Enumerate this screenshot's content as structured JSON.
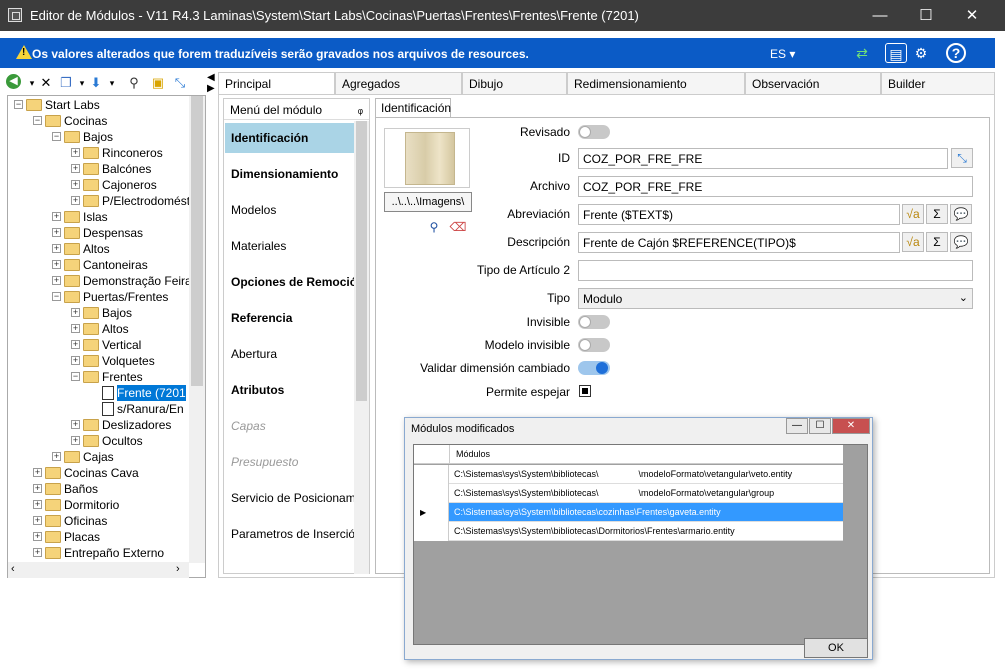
{
  "window": {
    "title": "Editor de Módulos - V11 R4.3 Laminas\\System\\Start Labs\\Cocinas\\Puertas\\Frentes\\Frentes\\Frente (7201)",
    "minimize": "—",
    "maximize": "☐",
    "close": "✕"
  },
  "infobar": {
    "message": "Os valores alterados que forem traduzíveis serão gravados nos arquivos de resources.",
    "language": "ES ▾",
    "bg_color": "#0b5bc6"
  },
  "tree": {
    "nodes": [
      {
        "label": "Start Labs",
        "level": 0,
        "expander": "−",
        "icon": "folder-open-icon"
      },
      {
        "label": "Cocinas",
        "level": 1,
        "expander": "−",
        "icon": "folder-open-icon"
      },
      {
        "label": "Bajos",
        "level": 2,
        "expander": "−",
        "icon": "folder-open-icon"
      },
      {
        "label": "Rinconeros",
        "level": 3,
        "expander": "+",
        "icon": "folder-icon"
      },
      {
        "label": "Balcónes",
        "level": 3,
        "expander": "+",
        "icon": "folder-icon"
      },
      {
        "label": "Cajoneros",
        "level": 3,
        "expander": "+",
        "icon": "folder-icon"
      },
      {
        "label": "P/Electrodomést",
        "level": 3,
        "expander": "+",
        "icon": "folder-icon"
      },
      {
        "label": "Islas",
        "level": 2,
        "expander": "+",
        "icon": "folder-icon"
      },
      {
        "label": "Despensas",
        "level": 2,
        "expander": "+",
        "icon": "folder-icon"
      },
      {
        "label": "Altos",
        "level": 2,
        "expander": "+",
        "icon": "folder-icon"
      },
      {
        "label": "Cantoneiras",
        "level": 2,
        "expander": "+",
        "icon": "folder-icon"
      },
      {
        "label": "Demonstração Feira",
        "level": 2,
        "expander": "+",
        "icon": "folder-icon"
      },
      {
        "label": "Puertas/Frentes",
        "level": 2,
        "expander": "−",
        "icon": "folder-open-icon"
      },
      {
        "label": "Bajos",
        "level": 3,
        "expander": "+",
        "icon": "folder-icon"
      },
      {
        "label": "Altos",
        "level": 3,
        "expander": "+",
        "icon": "folder-icon"
      },
      {
        "label": "Vertical",
        "level": 3,
        "expander": "+",
        "icon": "folder-icon"
      },
      {
        "label": "Volquetes",
        "level": 3,
        "expander": "+",
        "icon": "folder-icon"
      },
      {
        "label": "Frentes",
        "level": 3,
        "expander": "−",
        "icon": "folder-open-icon"
      },
      {
        "label": "Frente (7201",
        "level": 4,
        "expander": "",
        "icon": "module-icon",
        "selected": true
      },
      {
        "label": "s/Ranura/En",
        "level": 4,
        "expander": "",
        "icon": "module-icon"
      },
      {
        "label": "Deslizadores",
        "level": 3,
        "expander": "+",
        "icon": "folder-icon"
      },
      {
        "label": "Ocultos",
        "level": 3,
        "expander": "+",
        "icon": "folder-icon"
      },
      {
        "label": "Cajas",
        "level": 2,
        "expander": "+",
        "icon": "folder-icon"
      },
      {
        "label": "Cocinas Cava",
        "level": 1,
        "expander": "+",
        "icon": "folder-icon"
      },
      {
        "label": "Baños",
        "level": 1,
        "expander": "+",
        "icon": "folder-icon"
      },
      {
        "label": "Dormitorio",
        "level": 1,
        "expander": "+",
        "icon": "folder-icon"
      },
      {
        "label": "Oficinas",
        "level": 1,
        "expander": "+",
        "icon": "folder-icon"
      },
      {
        "label": "Placas",
        "level": 1,
        "expander": "+",
        "icon": "folder-icon"
      },
      {
        "label": "Entrepaño Externo",
        "level": 1,
        "expander": "+",
        "icon": "folder-icon"
      }
    ]
  },
  "tabs": [
    "Principal",
    "Agregados",
    "Dibujo",
    "Redimensionamiento",
    "Observación",
    "Builder"
  ],
  "menu": {
    "title": "Menú del módulo",
    "pin": "ᵩ",
    "items": [
      {
        "label": "Identificación",
        "style": "bold",
        "selected": true
      },
      {
        "label": "Dimensionamiento",
        "style": "bold"
      },
      {
        "label": "Modelos",
        "style": "normal"
      },
      {
        "label": "Materiales",
        "style": "normal"
      },
      {
        "label": "Opciones de Remoción",
        "style": "bold"
      },
      {
        "label": "Referencia",
        "style": "bold"
      },
      {
        "label": "Abertura",
        "style": "normal"
      },
      {
        "label": "Atributos",
        "style": "bold"
      },
      {
        "label": "Capas",
        "style": "italic"
      },
      {
        "label": "Presupuesto",
        "style": "italic"
      },
      {
        "label": "Servicio de Posicionamie",
        "style": "normal"
      },
      {
        "label": "Parametros de Inserción",
        "style": "normal"
      }
    ]
  },
  "identificacion": {
    "tab": "Identificación",
    "image_path": "..\\..\\..\\Imagens\\",
    "labels": {
      "revisado": "Revisado",
      "id": "ID",
      "archivo": "Archivo",
      "abreviacion": "Abreviación",
      "descripcion": "Descripción",
      "tipo_articulo": "Tipo de Artículo 2",
      "tipo": "Tipo",
      "invisible": "Invisible",
      "modelo_invisible": "Modelo invisible",
      "validar": "Validar dimensión cambiado",
      "permite_espejar": "Permite espejar"
    },
    "values": {
      "id": "COZ_POR_FRE_FRE",
      "archivo": "COZ_POR_FRE_FRE",
      "abreviacion": "Frente ($TEXT$)",
      "descripcion": "Frente de Cajón  $REFERENCE(TIPO)$",
      "tipo_articulo": "",
      "tipo": "Modulo"
    },
    "toggles": {
      "revisado": false,
      "invisible": false,
      "modelo_invisible": false,
      "validar": true
    },
    "permite_espejar": true
  },
  "dialog": {
    "title": "Módulos modificados",
    "column": "Módulos",
    "rows": [
      "C:\\Sistemas\\sys\\System\\bibliotecas\\                \\modeloFormato\\vetangular\\veto.entity",
      "C:\\Sistemas\\sys\\System\\bibliotecas\\                \\modeloFormato\\vetangular\\group",
      "C:\\Sistemas\\sys\\System\\bibliotecas\\cozinhas\\Frentes\\gaveta.entity",
      "C:\\Sistemas\\sys\\System\\bibliotecas\\Dormitorios\\Frentes\\armario.entity"
    ],
    "selected_row": 2,
    "ok": "OK"
  }
}
